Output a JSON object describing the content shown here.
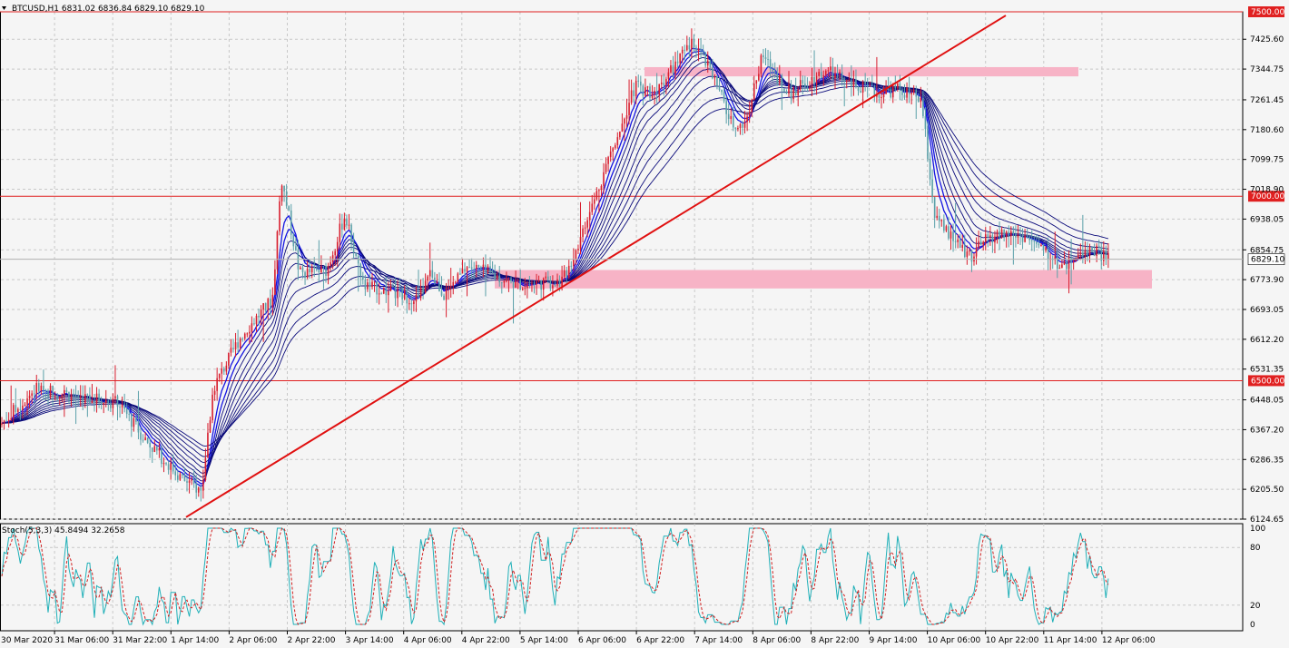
{
  "main_header": "BTCUSD,H1  6831.02 6836.84 6829.10 6829.10",
  "osc_header": "Stoch(5,3,3) 45.8494 32.2658",
  "colors": {
    "background": "#f5f5f5",
    "grid": "#c8c8c8",
    "bull_candle": "#d81e2e",
    "bear_candle": "#5aa0a8",
    "ema_bundle": "#0a0a7a",
    "fast_ema": "#1515e0",
    "hline": "#e02020",
    "trendline": "#e01010",
    "zone": "#f7b3c6",
    "stoch_main": "#20b0b8",
    "stoch_signal": "#d02020",
    "price_marker_bg": "#ffffff"
  },
  "current_price": "6829.10",
  "chart_data": [
    {
      "type": "candlestick",
      "symbol": "BTCUSD",
      "timeframe": "H1",
      "y_ticks": [
        "7425.60",
        "7344.75",
        "7261.45",
        "7180.60",
        "7099.75",
        "7018.90",
        "6938.05",
        "6854.75",
        "6773.90",
        "6693.05",
        "6612.20",
        "6531.35",
        "6448.05",
        "6367.20",
        "6286.35",
        "6205.50",
        "6124.65"
      ],
      "y_range": [
        6124.65,
        7500
      ],
      "x_ticks": [
        "30 Mar 2020",
        "31 Mar 06:00",
        "31 Mar 22:00",
        "1 Apr 14:00",
        "2 Apr 06:00",
        "2 Apr 22:00",
        "3 Apr 14:00",
        "4 Apr 06:00",
        "4 Apr 22:00",
        "5 Apr 14:00",
        "6 Apr 06:00",
        "6 Apr 22:00",
        "7 Apr 14:00",
        "8 Apr 06:00",
        "8 Apr 22:00",
        "9 Apr 14:00",
        "10 Apr 06:00",
        "10 Apr 22:00",
        "11 Apr 14:00",
        "12 Apr 06:00"
      ],
      "price_path_anchors": [
        [
          0,
          6380
        ],
        [
          40,
          6480
        ],
        [
          80,
          6460
        ],
        [
          130,
          6440
        ],
        [
          160,
          6340
        ],
        [
          200,
          6235
        ],
        [
          222,
          6200
        ],
        [
          235,
          6480
        ],
        [
          265,
          6620
        ],
        [
          300,
          6720
        ],
        [
          310,
          7050
        ],
        [
          330,
          6790
        ],
        [
          360,
          6800
        ],
        [
          380,
          6950
        ],
        [
          400,
          6760
        ],
        [
          430,
          6740
        ],
        [
          460,
          6720
        ],
        [
          475,
          6790
        ],
        [
          490,
          6730
        ],
        [
          515,
          6810
        ],
        [
          540,
          6790
        ],
        [
          570,
          6760
        ],
        [
          620,
          6770
        ],
        [
          645,
          6920
        ],
        [
          670,
          7100
        ],
        [
          700,
          7300
        ],
        [
          720,
          7280
        ],
        [
          745,
          7360
        ],
        [
          765,
          7420
        ],
        [
          790,
          7300
        ],
        [
          805,
          7200
        ],
        [
          820,
          7190
        ],
        [
          840,
          7380
        ],
        [
          870,
          7280
        ],
        [
          910,
          7340
        ],
        [
          940,
          7300
        ],
        [
          965,
          7280
        ],
        [
          990,
          7290
        ],
        [
          1015,
          7260
        ],
        [
          1030,
          6940
        ],
        [
          1050,
          6880
        ],
        [
          1070,
          6840
        ],
        [
          1090,
          6890
        ],
        [
          1110,
          6900
        ],
        [
          1130,
          6890
        ],
        [
          1150,
          6850
        ],
        [
          1170,
          6810
        ],
        [
          1190,
          6840
        ],
        [
          1200,
          6860
        ],
        [
          1223,
          6829
        ]
      ],
      "horizontal_levels": [
        "7500.00",
        "7000.00",
        "6500.00"
      ],
      "resistance_zone": [
        7325,
        7350
      ],
      "support_zone": [
        6750,
        6800
      ],
      "trendline": [
        [
          6130,
          "1 Apr"
        ],
        [
          7490,
          "9 Apr"
        ]
      ],
      "ema_count": 10
    },
    {
      "type": "line",
      "name": "Stoch(5,3,3)",
      "main": 45.8494,
      "signal": 32.2658,
      "y_ticks": [
        "100",
        "80",
        "20",
        "0"
      ],
      "y_range": [
        0,
        100
      ],
      "levels": [
        80,
        20
      ]
    }
  ]
}
